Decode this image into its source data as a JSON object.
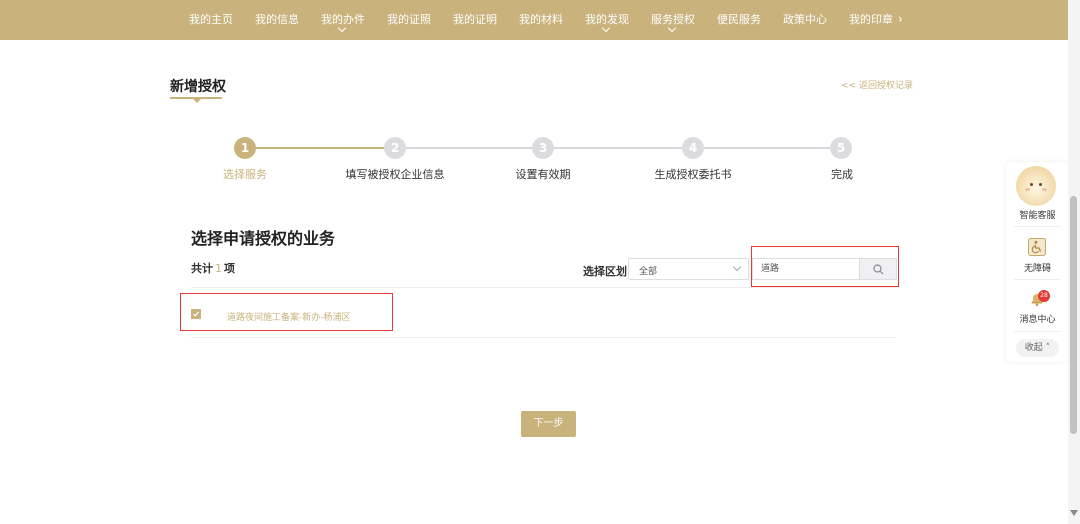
{
  "nav": {
    "items": [
      {
        "label": "我的主页"
      },
      {
        "label": "我的信息"
      },
      {
        "label": "我的办件",
        "dropdown": true
      },
      {
        "label": "我的证照"
      },
      {
        "label": "我的证明"
      },
      {
        "label": "我的材料"
      },
      {
        "label": "我的发现",
        "dropdown": true
      },
      {
        "label": "服务授权",
        "dropdown": true
      },
      {
        "label": "便民服务"
      },
      {
        "label": "政策中心"
      },
      {
        "label": "我的印章"
      }
    ],
    "more_icon": "chevron-right-icon"
  },
  "page": {
    "title": "新增授权",
    "back_link": "<< 返回授权记录"
  },
  "steps": [
    {
      "num": "1",
      "label": "选择服务",
      "active": true
    },
    {
      "num": "2",
      "label": "填写被授权企业信息",
      "active": false
    },
    {
      "num": "3",
      "label": "设置有效期",
      "active": false
    },
    {
      "num": "4",
      "label": "生成授权委托书",
      "active": false
    },
    {
      "num": "5",
      "label": "完成",
      "active": false
    }
  ],
  "main": {
    "section_title": "选择申请授权的业务",
    "count_prefix": "共计",
    "count": "1",
    "count_suffix": "项",
    "district_label": "选择区划",
    "district_value": "全部",
    "search_value": "道路",
    "search_icon": "search-icon",
    "items": [
      {
        "label": "道路夜间施工备案-新办-杨浦区",
        "checked": true
      }
    ],
    "next_label": "下一步"
  },
  "side": {
    "assistant_label": "智能客服",
    "accessibility_label": "无障碍",
    "messages_label": "消息中心",
    "messages_badge": "28",
    "collapse_label": "收起"
  },
  "colors": {
    "accent": "#c9b27c",
    "highlight": "#e53935"
  }
}
